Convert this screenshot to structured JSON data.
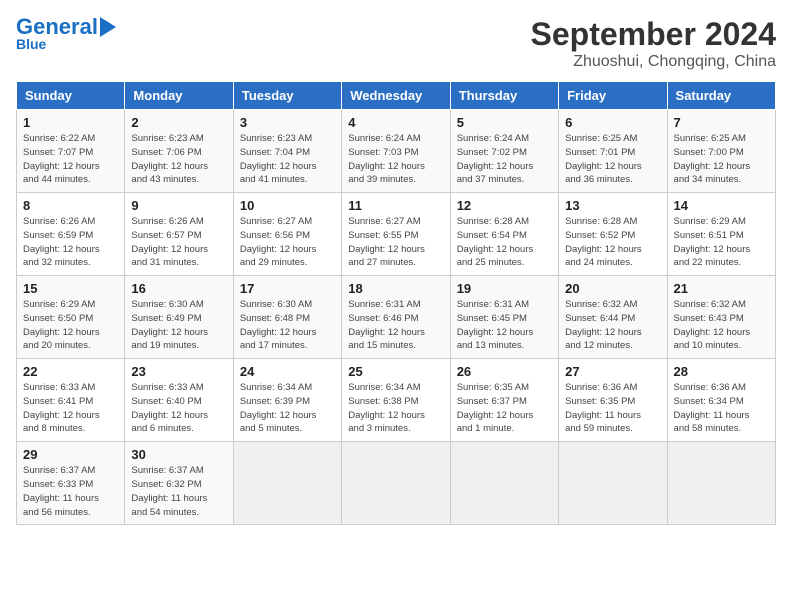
{
  "logo": {
    "line1a": "General",
    "line1b": "Blue",
    "line2": "Blue"
  },
  "title": "September 2024",
  "subtitle": "Zhuoshui, Chongqing, China",
  "days_of_week": [
    "Sunday",
    "Monday",
    "Tuesday",
    "Wednesday",
    "Thursday",
    "Friday",
    "Saturday"
  ],
  "weeks": [
    [
      {
        "day": "1",
        "info": "Sunrise: 6:22 AM\nSunset: 7:07 PM\nDaylight: 12 hours\nand 44 minutes."
      },
      {
        "day": "2",
        "info": "Sunrise: 6:23 AM\nSunset: 7:06 PM\nDaylight: 12 hours\nand 43 minutes."
      },
      {
        "day": "3",
        "info": "Sunrise: 6:23 AM\nSunset: 7:04 PM\nDaylight: 12 hours\nand 41 minutes."
      },
      {
        "day": "4",
        "info": "Sunrise: 6:24 AM\nSunset: 7:03 PM\nDaylight: 12 hours\nand 39 minutes."
      },
      {
        "day": "5",
        "info": "Sunrise: 6:24 AM\nSunset: 7:02 PM\nDaylight: 12 hours\nand 37 minutes."
      },
      {
        "day": "6",
        "info": "Sunrise: 6:25 AM\nSunset: 7:01 PM\nDaylight: 12 hours\nand 36 minutes."
      },
      {
        "day": "7",
        "info": "Sunrise: 6:25 AM\nSunset: 7:00 PM\nDaylight: 12 hours\nand 34 minutes."
      }
    ],
    [
      {
        "day": "8",
        "info": "Sunrise: 6:26 AM\nSunset: 6:59 PM\nDaylight: 12 hours\nand 32 minutes."
      },
      {
        "day": "9",
        "info": "Sunrise: 6:26 AM\nSunset: 6:57 PM\nDaylight: 12 hours\nand 31 minutes."
      },
      {
        "day": "10",
        "info": "Sunrise: 6:27 AM\nSunset: 6:56 PM\nDaylight: 12 hours\nand 29 minutes."
      },
      {
        "day": "11",
        "info": "Sunrise: 6:27 AM\nSunset: 6:55 PM\nDaylight: 12 hours\nand 27 minutes."
      },
      {
        "day": "12",
        "info": "Sunrise: 6:28 AM\nSunset: 6:54 PM\nDaylight: 12 hours\nand 25 minutes."
      },
      {
        "day": "13",
        "info": "Sunrise: 6:28 AM\nSunset: 6:52 PM\nDaylight: 12 hours\nand 24 minutes."
      },
      {
        "day": "14",
        "info": "Sunrise: 6:29 AM\nSunset: 6:51 PM\nDaylight: 12 hours\nand 22 minutes."
      }
    ],
    [
      {
        "day": "15",
        "info": "Sunrise: 6:29 AM\nSunset: 6:50 PM\nDaylight: 12 hours\nand 20 minutes."
      },
      {
        "day": "16",
        "info": "Sunrise: 6:30 AM\nSunset: 6:49 PM\nDaylight: 12 hours\nand 19 minutes."
      },
      {
        "day": "17",
        "info": "Sunrise: 6:30 AM\nSunset: 6:48 PM\nDaylight: 12 hours\nand 17 minutes."
      },
      {
        "day": "18",
        "info": "Sunrise: 6:31 AM\nSunset: 6:46 PM\nDaylight: 12 hours\nand 15 minutes."
      },
      {
        "day": "19",
        "info": "Sunrise: 6:31 AM\nSunset: 6:45 PM\nDaylight: 12 hours\nand 13 minutes."
      },
      {
        "day": "20",
        "info": "Sunrise: 6:32 AM\nSunset: 6:44 PM\nDaylight: 12 hours\nand 12 minutes."
      },
      {
        "day": "21",
        "info": "Sunrise: 6:32 AM\nSunset: 6:43 PM\nDaylight: 12 hours\nand 10 minutes."
      }
    ],
    [
      {
        "day": "22",
        "info": "Sunrise: 6:33 AM\nSunset: 6:41 PM\nDaylight: 12 hours\nand 8 minutes."
      },
      {
        "day": "23",
        "info": "Sunrise: 6:33 AM\nSunset: 6:40 PM\nDaylight: 12 hours\nand 6 minutes."
      },
      {
        "day": "24",
        "info": "Sunrise: 6:34 AM\nSunset: 6:39 PM\nDaylight: 12 hours\nand 5 minutes."
      },
      {
        "day": "25",
        "info": "Sunrise: 6:34 AM\nSunset: 6:38 PM\nDaylight: 12 hours\nand 3 minutes."
      },
      {
        "day": "26",
        "info": "Sunrise: 6:35 AM\nSunset: 6:37 PM\nDaylight: 12 hours\nand 1 minute."
      },
      {
        "day": "27",
        "info": "Sunrise: 6:36 AM\nSunset: 6:35 PM\nDaylight: 11 hours\nand 59 minutes."
      },
      {
        "day": "28",
        "info": "Sunrise: 6:36 AM\nSunset: 6:34 PM\nDaylight: 11 hours\nand 58 minutes."
      }
    ],
    [
      {
        "day": "29",
        "info": "Sunrise: 6:37 AM\nSunset: 6:33 PM\nDaylight: 11 hours\nand 56 minutes."
      },
      {
        "day": "30",
        "info": "Sunrise: 6:37 AM\nSunset: 6:32 PM\nDaylight: 11 hours\nand 54 minutes."
      },
      {
        "day": "",
        "info": ""
      },
      {
        "day": "",
        "info": ""
      },
      {
        "day": "",
        "info": ""
      },
      {
        "day": "",
        "info": ""
      },
      {
        "day": "",
        "info": ""
      }
    ]
  ]
}
